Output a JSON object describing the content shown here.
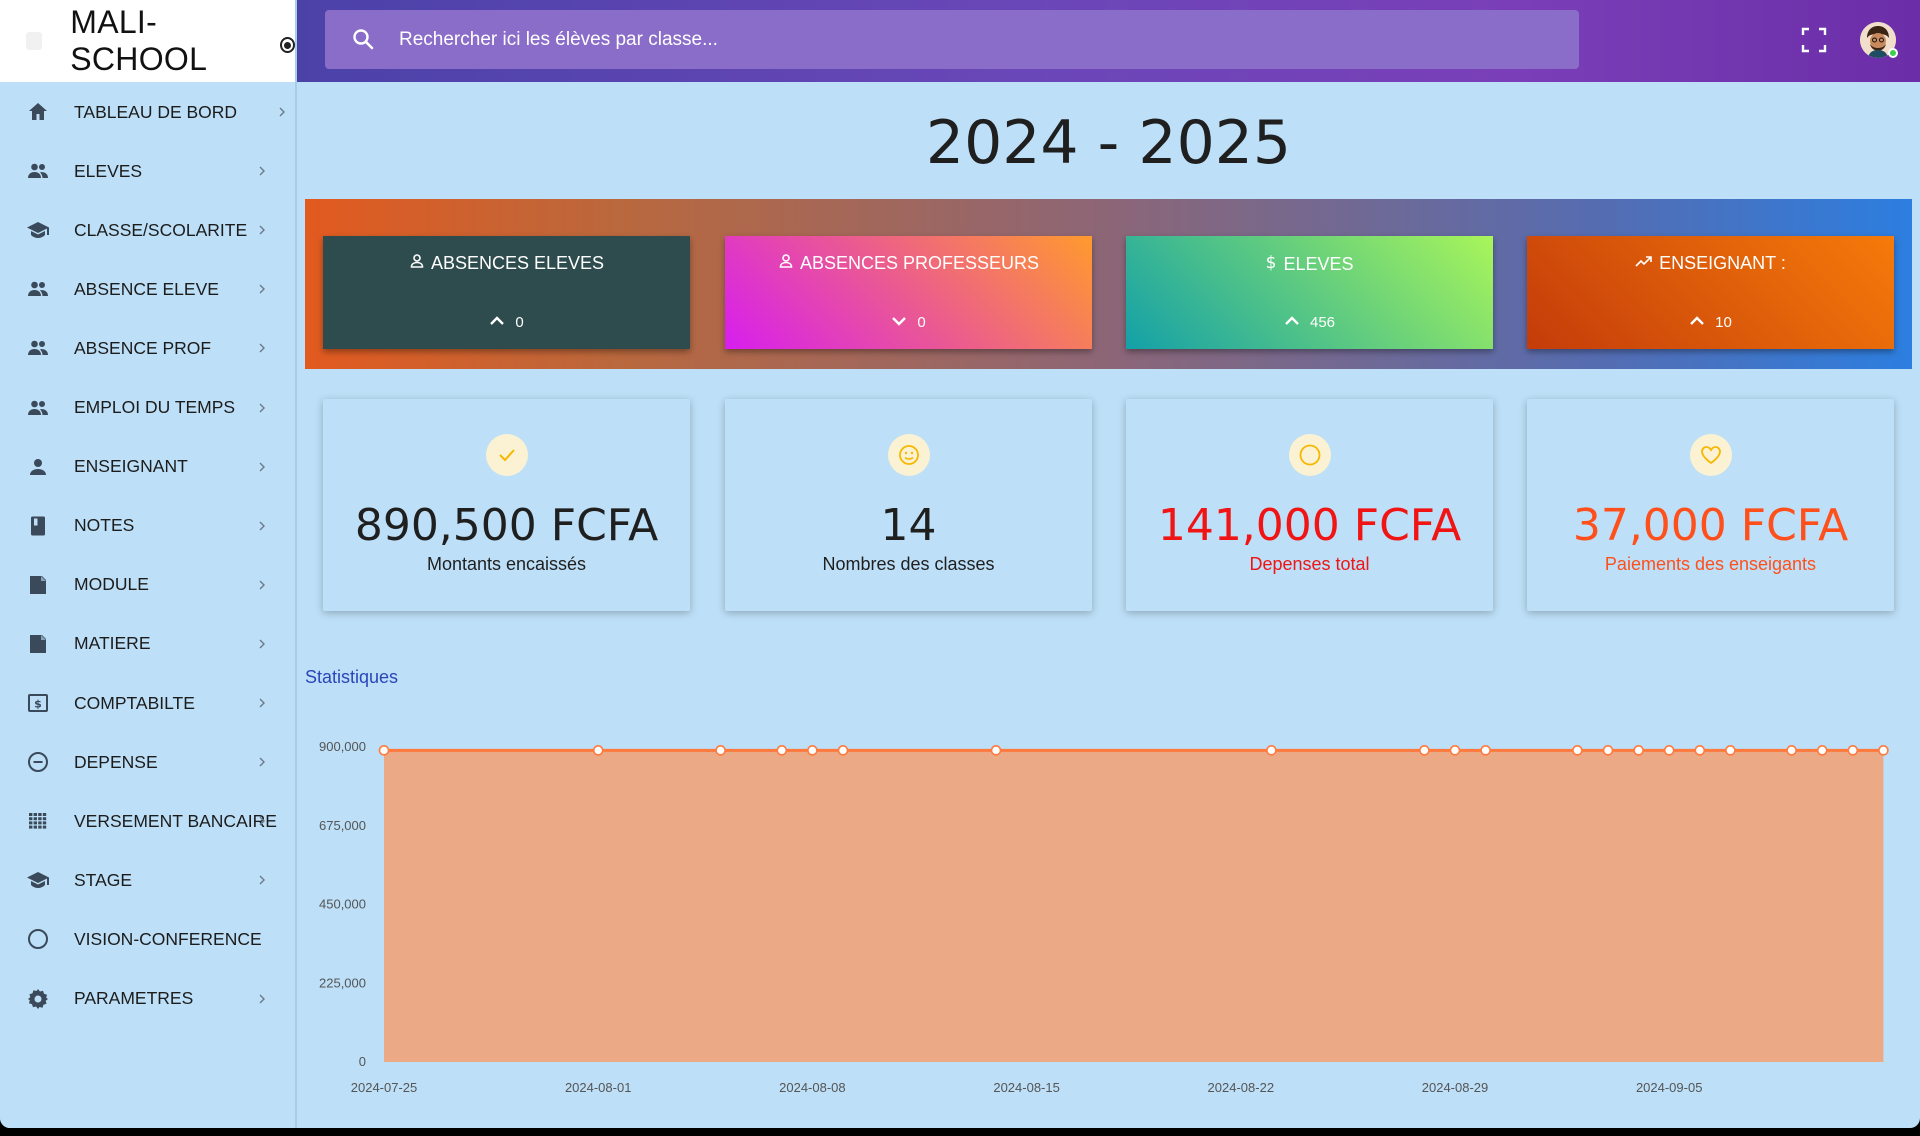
{
  "brand": {
    "title": "MALI-SCHOOL"
  },
  "search": {
    "placeholder": "Rechercher ici les élèves par classe..."
  },
  "sidebar": {
    "items": [
      {
        "label": "TABLEAU DE BORD",
        "icon": "home-icon"
      },
      {
        "label": "ELEVES",
        "icon": "people-icon"
      },
      {
        "label": "CLASSE/SCOLARITE",
        "icon": "graduation-cap-icon"
      },
      {
        "label": "ABSENCE ELEVE",
        "icon": "people-icon"
      },
      {
        "label": "ABSENCE PROF",
        "icon": "people-icon"
      },
      {
        "label": "EMPLOI DU TEMPS",
        "icon": "people-icon"
      },
      {
        "label": "ENSEIGNANT",
        "icon": "person-icon"
      },
      {
        "label": "NOTES",
        "icon": "book-icon"
      },
      {
        "label": "MODULE",
        "icon": "note-icon"
      },
      {
        "label": "MATIERE",
        "icon": "note-icon"
      },
      {
        "label": "COMPTABILTE",
        "icon": "money-icon"
      },
      {
        "label": "DEPENSE",
        "icon": "minus-circle-icon"
      },
      {
        "label": "VERSEMENT BANCAIRE",
        "icon": "grid-icon"
      },
      {
        "label": "STAGE",
        "icon": "graduation-cap-icon"
      },
      {
        "label": "VISION-CONFERENCE",
        "icon": "circle-icon"
      },
      {
        "label": "PARAMETRES",
        "icon": "gear-icon"
      }
    ]
  },
  "main": {
    "year": "2024 - 2025",
    "gradient_cards": [
      {
        "title": "ABSENCES ELEVES",
        "icon": "person-outline-icon",
        "trend": "up",
        "value": "0",
        "colors": [
          "#2e4c4d",
          "#2e4c4d"
        ]
      },
      {
        "title": "ABSENCES PROFESSEURS",
        "icon": "person-outline-icon",
        "trend": "down",
        "value": "0",
        "colors": [
          "#d71eef",
          "#ff9a2e"
        ]
      },
      {
        "title": "ELEVES",
        "icon": "dollar-icon",
        "trend": "up",
        "value": "456",
        "colors": [
          "#13a0a8",
          "#a9f55a"
        ]
      },
      {
        "title": "ENSEIGNANT :",
        "icon": "trending-up-icon",
        "trend": "up",
        "value": "10",
        "colors": [
          "#c43c0a",
          "#f57b0a"
        ]
      }
    ],
    "stat_cards": [
      {
        "value": "890,500 FCFA",
        "label": "Montants encaissés",
        "icon": "check-icon",
        "color": "#1f1f1f"
      },
      {
        "value": "14",
        "label": "Nombres des classes",
        "icon": "smile-icon",
        "color": "#1f1f1f"
      },
      {
        "value": "141,000 FCFA",
        "label": "Depenses total",
        "icon": "circle-icon",
        "color": "#f01414"
      },
      {
        "value": "37,000 FCFA",
        "label": "Paiements des enseigants",
        "icon": "heart-icon",
        "color": "#ff4f1a"
      }
    ],
    "statistics_label": "Statistiques"
  },
  "chart_data": {
    "type": "area",
    "title": "",
    "xlabel": "",
    "ylabel": "",
    "ylim": [
      0,
      900000
    ],
    "yticks": [
      "900,000",
      "675,000",
      "450,000",
      "225,000",
      "0"
    ],
    "ytick_values": [
      900000,
      675000,
      450000,
      225000,
      0
    ],
    "xticks": [
      "2024-07-25",
      "2024-08-01",
      "2024-08-08",
      "2024-08-15",
      "2024-08-22",
      "2024-08-29",
      "2024-09-05"
    ],
    "series": [
      {
        "x": [
          "2024-07-25",
          "2024-08-01",
          "2024-08-05",
          "2024-08-07",
          "2024-08-08",
          "2024-08-09",
          "2024-08-14",
          "2024-08-23",
          "2024-08-28",
          "2024-08-29",
          "2024-08-30",
          "2024-09-02",
          "2024-09-03",
          "2024-09-04",
          "2024-09-05",
          "2024-09-06",
          "2024-09-07",
          "2024-09-09",
          "2024-09-10",
          "2024-09-11",
          "2024-09-12"
        ],
        "values": [
          890500,
          890500,
          890500,
          890500,
          890500,
          890500,
          890500,
          890500,
          890500,
          890500,
          890500,
          890500,
          890500,
          890500,
          890500,
          890500,
          890500,
          890500,
          890500,
          890500,
          890500
        ],
        "color": "#ff7a3c",
        "fill": "#eba986"
      }
    ]
  }
}
